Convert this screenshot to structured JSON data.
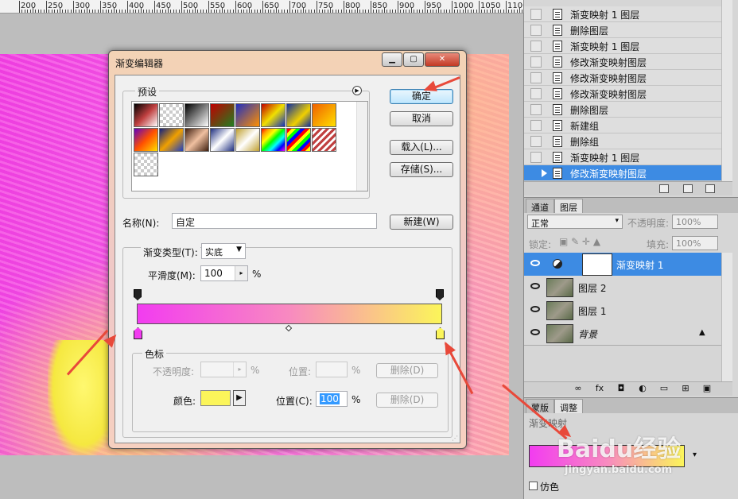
{
  "ruler": {
    "labels": [
      "200",
      "250",
      "300",
      "350",
      "400",
      "450",
      "500",
      "550",
      "600",
      "650",
      "700",
      "750",
      "800",
      "850",
      "900",
      "950",
      "1000",
      "1050",
      "1100"
    ]
  },
  "history": {
    "items": [
      {
        "label": "渐变映射 1 图层",
        "active": false
      },
      {
        "label": "删除图层",
        "active": false
      },
      {
        "label": "渐变映射 1 图层",
        "active": false
      },
      {
        "label": "修改渐变映射图层",
        "active": false
      },
      {
        "label": "修改渐变映射图层",
        "active": false
      },
      {
        "label": "修改渐变映射图层",
        "active": false
      },
      {
        "label": "删除图层",
        "active": false
      },
      {
        "label": "新建组",
        "active": false
      },
      {
        "label": "删除组",
        "active": false
      },
      {
        "label": "渐变映射 1 图层",
        "active": false
      },
      {
        "label": "修改渐变映射图层",
        "active": true
      }
    ]
  },
  "layers_panel": {
    "tabs": [
      "通道",
      "图层"
    ],
    "blend_mode": "正常",
    "opacity_label": "不透明度:",
    "opacity_value": "100%",
    "lock_label": "锁定:",
    "fill_label": "填充:",
    "fill_value": "100%",
    "layers": [
      {
        "name": "渐变映射 1",
        "active": true
      },
      {
        "name": "图层 2",
        "active": false
      },
      {
        "name": "图层 1",
        "active": false
      },
      {
        "name": "背景",
        "active": false
      }
    ],
    "bottom_icons": [
      "∞",
      "fx",
      "◘",
      "◐",
      "▭",
      "⊞",
      "▣"
    ]
  },
  "adjust_panel": {
    "tabs": [
      "蒙版",
      "调整"
    ],
    "title": "渐变映射",
    "dither_label": "仿色"
  },
  "dialog": {
    "title": "渐变编辑器",
    "presets_label": "预设",
    "ok": "确定",
    "cancel": "取消",
    "load": "载入(L)...",
    "save": "存储(S)...",
    "name_label": "名称(N):",
    "name_value": "自定",
    "new_button": "新建(W)",
    "gradient_type_label": "渐变类型(T):",
    "gradient_type_value": "实底",
    "smoothness_label": "平滑度(M):",
    "smoothness_value": "100",
    "smoothness_unit": "%",
    "stops_group": "色标",
    "opacity_label": "不透明度:",
    "opacity_unit": "%",
    "location_label": "位置:",
    "location_unit": "%",
    "delete_label": "删除(D)",
    "color_label": "颜色:",
    "location_c_label": "位置(C):",
    "location_c_value": "100",
    "location_c_unit": "%"
  },
  "gradient": {
    "start_color": "#f23cf0",
    "end_color": "#fbf55a"
  },
  "watermark": {
    "text": "Baidu经验",
    "url": "jingyan.baidu.com"
  }
}
